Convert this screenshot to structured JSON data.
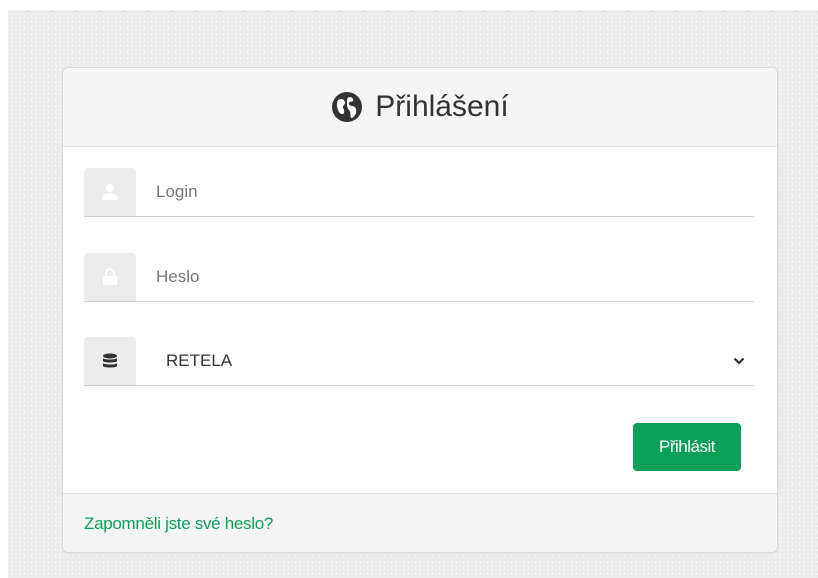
{
  "header": {
    "title": "Přihlášení",
    "icon": "globe-icon"
  },
  "form": {
    "login": {
      "placeholder": "Login",
      "value": "",
      "icon": "user-icon"
    },
    "password": {
      "placeholder": "Heslo",
      "value": "",
      "icon": "lock-icon"
    },
    "database": {
      "selected": "RETELA",
      "icon": "database-icon"
    },
    "submit_label": "Přihlásit"
  },
  "footer": {
    "forgot_password_link": "Zapomněli jste své heslo?"
  },
  "colors": {
    "accent": "#0ba05a",
    "header_bg": "#f5f5f5",
    "addon_bg": "#ececec"
  }
}
